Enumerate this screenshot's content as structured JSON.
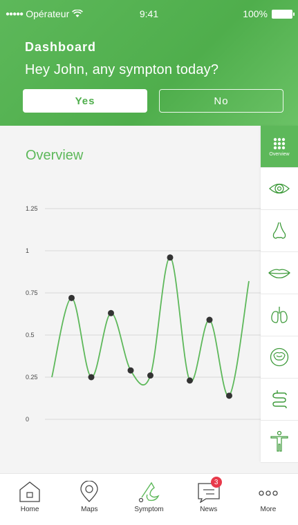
{
  "status_bar": {
    "carrier": "Opérateur",
    "time": "9:41",
    "battery": "100%"
  },
  "header": {
    "title": "Dashboard",
    "question": "Hey John, any sympton today?",
    "yes_label": "Yes",
    "no_label": "No"
  },
  "overview": {
    "title": "Overview"
  },
  "chart_data": {
    "type": "line",
    "y_ticks": [
      "1.25",
      "1",
      "0.75",
      "0.5",
      "0.25",
      "0"
    ],
    "ylim": [
      0,
      1.25
    ],
    "grid": true,
    "line_color": "#5db85a",
    "point_color": "#333333",
    "points": [
      {
        "x": 0,
        "y": 0.25,
        "marker": false
      },
      {
        "x": 1,
        "y": 0.72,
        "marker": true
      },
      {
        "x": 2,
        "y": 0.25,
        "marker": true
      },
      {
        "x": 3,
        "y": 0.63,
        "marker": true
      },
      {
        "x": 4,
        "y": 0.29,
        "marker": true
      },
      {
        "x": 5,
        "y": 0.26,
        "marker": true
      },
      {
        "x": 6,
        "y": 0.96,
        "marker": true
      },
      {
        "x": 7,
        "y": 0.23,
        "marker": true
      },
      {
        "x": 8,
        "y": 0.59,
        "marker": true
      },
      {
        "x": 9,
        "y": 0.14,
        "marker": true
      },
      {
        "x": 10,
        "y": 0.82,
        "marker": false
      }
    ]
  },
  "side_nav": {
    "items": [
      {
        "icon": "grid-icon",
        "label": "Overview",
        "active": true
      },
      {
        "icon": "eye-icon",
        "label": "",
        "active": false
      },
      {
        "icon": "nose-icon",
        "label": "",
        "active": false
      },
      {
        "icon": "mouth-icon",
        "label": "",
        "active": false
      },
      {
        "icon": "lungs-icon",
        "label": "",
        "active": false
      },
      {
        "icon": "stomach-icon",
        "label": "",
        "active": false
      },
      {
        "icon": "intestine-icon",
        "label": "",
        "active": false
      },
      {
        "icon": "body-icon",
        "label": "",
        "active": false
      }
    ]
  },
  "tab_bar": {
    "tabs": [
      {
        "icon": "home-icon",
        "label": "Home"
      },
      {
        "icon": "map-pin-icon",
        "label": "Maps"
      },
      {
        "icon": "symptom-icon",
        "label": "Symptom"
      },
      {
        "icon": "news-icon",
        "label": "News",
        "badge": "3"
      },
      {
        "icon": "more-icon",
        "label": "More"
      }
    ]
  },
  "colors": {
    "accent": "#5db85a",
    "badge": "#e8394a"
  }
}
